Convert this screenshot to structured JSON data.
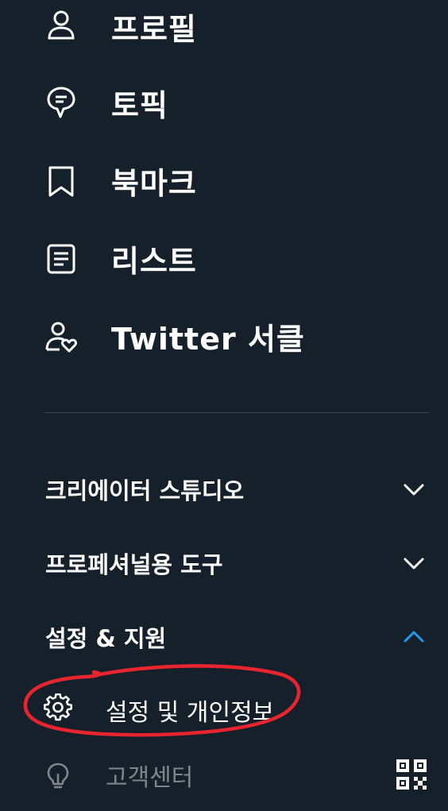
{
  "nav": {
    "items": [
      {
        "label": "프로필",
        "icon": "profile-icon"
      },
      {
        "label": "토픽",
        "icon": "topics-icon"
      },
      {
        "label": "북마크",
        "icon": "bookmark-icon"
      },
      {
        "label": "리스트",
        "icon": "lists-icon"
      },
      {
        "label": "Twitter 서클",
        "icon": "twitter-circle-icon"
      }
    ]
  },
  "sections": [
    {
      "label": "크리에이터 스튜디오",
      "state": "collapsed"
    },
    {
      "label": "프로페셔널용 도구",
      "state": "collapsed"
    },
    {
      "label": "설정 & 지원",
      "state": "expanded"
    }
  ],
  "settings_support": {
    "items": [
      {
        "label": "설정 및 개인정보",
        "icon": "gear-icon",
        "highlighted_by_annotation": true
      },
      {
        "label": "고객센터",
        "icon": "lightbulb-icon"
      }
    ]
  },
  "colors": {
    "background": "#15202b",
    "text": "#ffffff",
    "divider": "#38444d",
    "accent": "#1d9bf0",
    "annotation": "#e8242f"
  }
}
